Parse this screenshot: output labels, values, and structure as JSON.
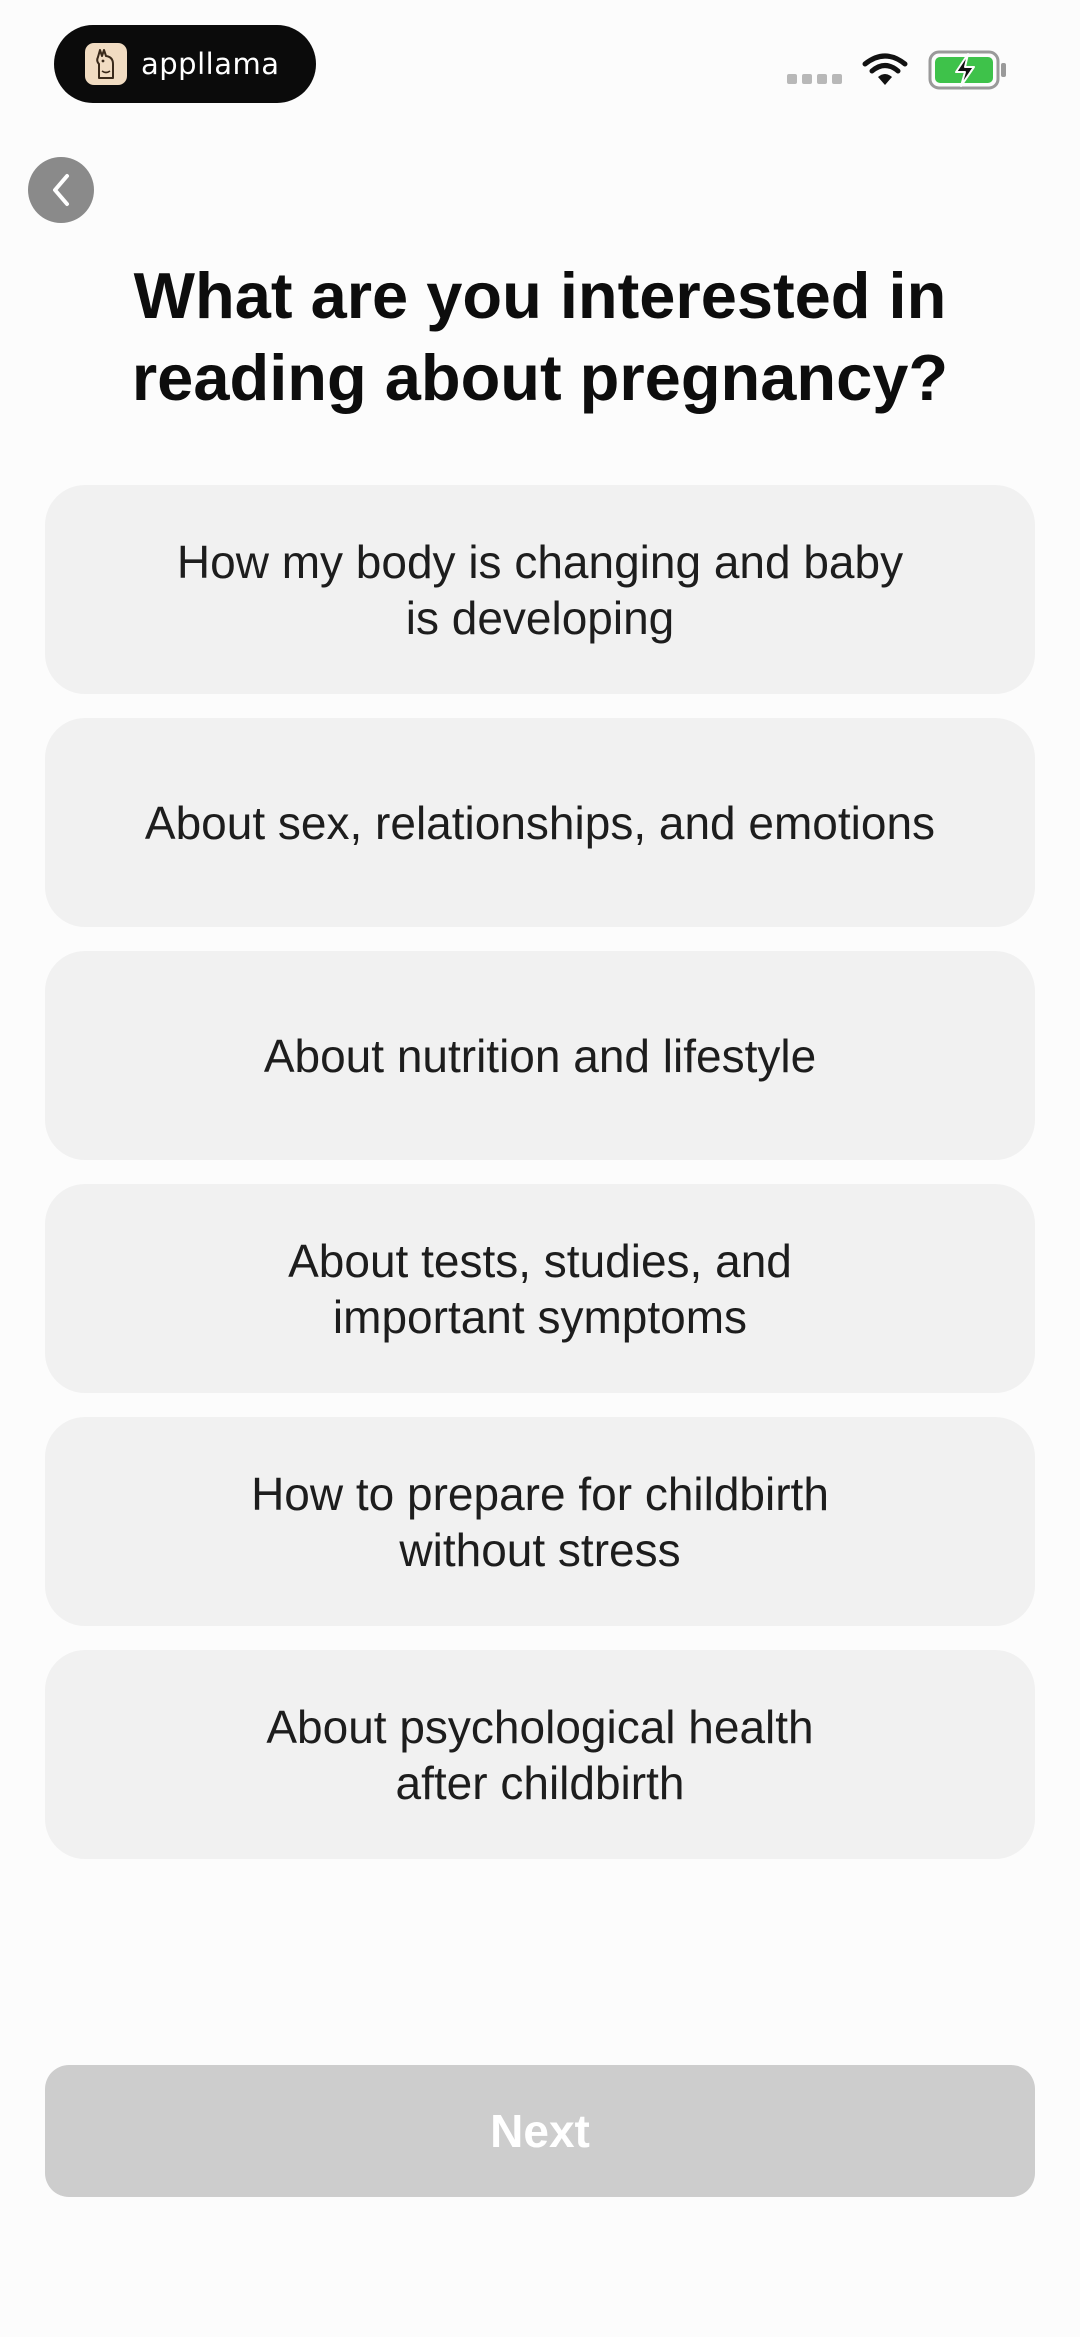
{
  "status_bar": {
    "brand_name": "appllama",
    "icons": [
      "appllama-logo-icon",
      "signal-icon",
      "wifi-icon",
      "battery-charging-icon"
    ],
    "battery_color": "#3ec24a"
  },
  "navigation": {
    "back_icon": "chevron-left-icon"
  },
  "title": "What are you interested in reading about pregnancy?",
  "options": [
    {
      "label": "How my body is changing and baby\nis developing"
    },
    {
      "label": "About sex, relationships, and emotions"
    },
    {
      "label": "About nutrition and lifestyle"
    },
    {
      "label": "About tests, studies, and\nimportant symptoms"
    },
    {
      "label": "How to prepare for childbirth\nwithout stress"
    },
    {
      "label": "About psychological health\nafter childbirth"
    }
  ],
  "next_button": {
    "label": "Next",
    "state": "disabled"
  },
  "colors": {
    "option_background": "#f1f1f1",
    "next_disabled": "#cdcdcd",
    "back_button": "#8a8a8a"
  }
}
